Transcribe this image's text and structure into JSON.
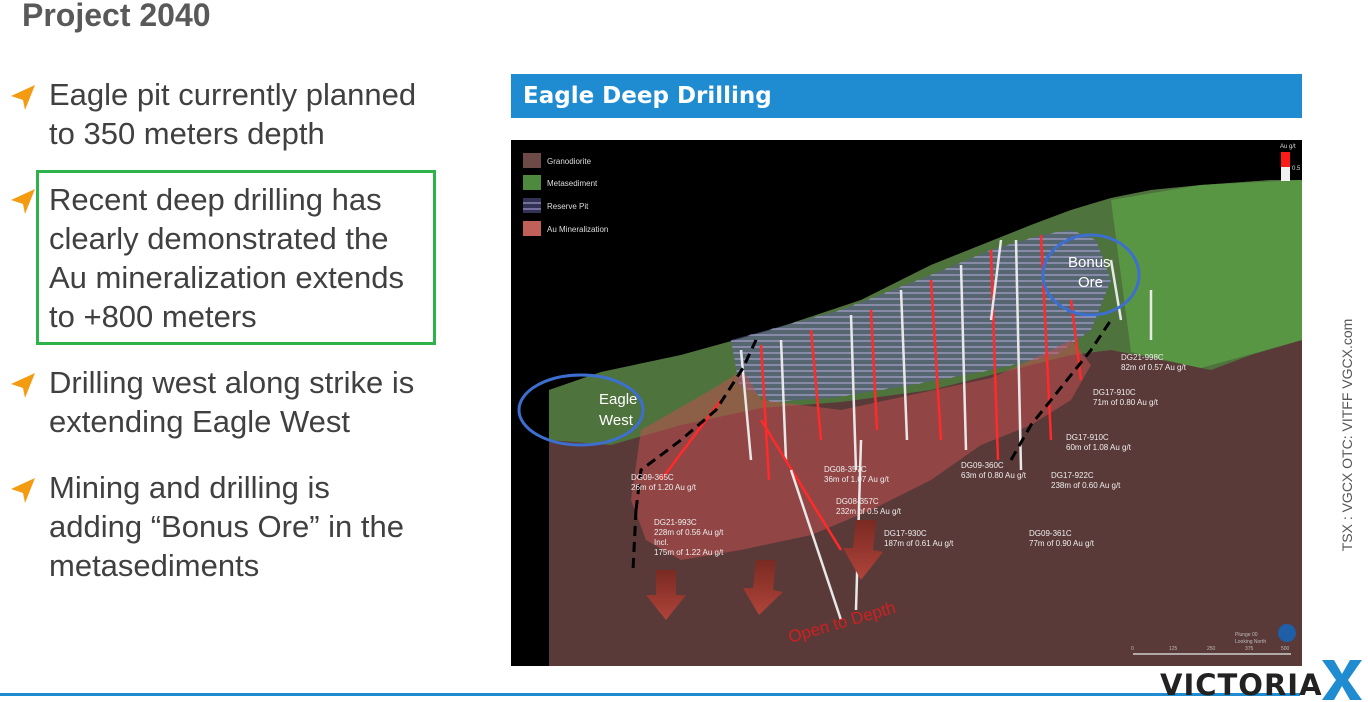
{
  "slide": {
    "title": "Project 2040",
    "bullets": [
      {
        "lines": [
          "Eagle pit currently planned",
          "to 350 meters depth"
        ]
      },
      {
        "lines": [
          "Recent deep drilling has",
          "clearly demonstrated the",
          "Au mineralization extends",
          "to +800 meters"
        ]
      },
      {
        "lines": [
          "Drilling west along strike is",
          "extending Eagle West"
        ]
      },
      {
        "lines": [
          "Mining and drilling is",
          "adding “Bonus Ore” in the",
          "metasediments"
        ]
      }
    ]
  },
  "panel": {
    "header": "Eagle Deep Drilling",
    "legend": [
      "Granodiorite",
      "Metasediment",
      "Reserve Pit",
      "Au Mineralization"
    ],
    "colorbar": {
      "title": "Au g/t",
      "tick": "0.5"
    },
    "callouts": {
      "eagle_west": [
        "Eagle",
        "West"
      ],
      "bonus_ore": [
        "Bonus",
        "Ore"
      ],
      "open_to_depth": "Open to Depth"
    },
    "holes": [
      {
        "id": "DG21-998C",
        "detail": "82m of 0.57 Au g/t"
      },
      {
        "id": "DG17-910C",
        "detail": "71m of 0.80 Au g/t"
      },
      {
        "id": "DG17-910C",
        "detail": "60m of 1.08 Au g/t"
      },
      {
        "id": "DG09-360C",
        "detail": "63m of 0.80 Au g/t"
      },
      {
        "id": "DG17-922C",
        "detail": "238m of 0.60 Au g/t"
      },
      {
        "id": "DG08-357C",
        "detail": "36m of 1.07 Au g/t"
      },
      {
        "id": "DG08-357C",
        "detail": "232m of 0.5 Au g/t"
      },
      {
        "id": "DG09-365C",
        "detail": "26m of 1.20 Au g/t"
      },
      {
        "id": "DG21-993C",
        "detail": "228m of 0.56 Au g/t",
        "extra": [
          "Incl.",
          "175m of 1.22 Au g/t"
        ]
      },
      {
        "id": "DG17-930C",
        "detail": "187m of 0.61 Au g/t"
      },
      {
        "id": "DG09-361C",
        "detail": "77m of 0.90 Au g/t"
      }
    ],
    "plunge": [
      "Plunge 00",
      "Looking North"
    ],
    "scale_ticks": [
      "0",
      "125",
      "250",
      "375",
      "500"
    ]
  },
  "sidebar": {
    "text": "TSX : VGCX     OTC: VITFF     VGCX.com"
  },
  "logo": {
    "text": "VICTORIA",
    "mark": "X"
  },
  "colors": {
    "accent_blue": "#1f8bd1",
    "highlight_green": "#2db34a",
    "arrow_orange": "#f39c12"
  }
}
